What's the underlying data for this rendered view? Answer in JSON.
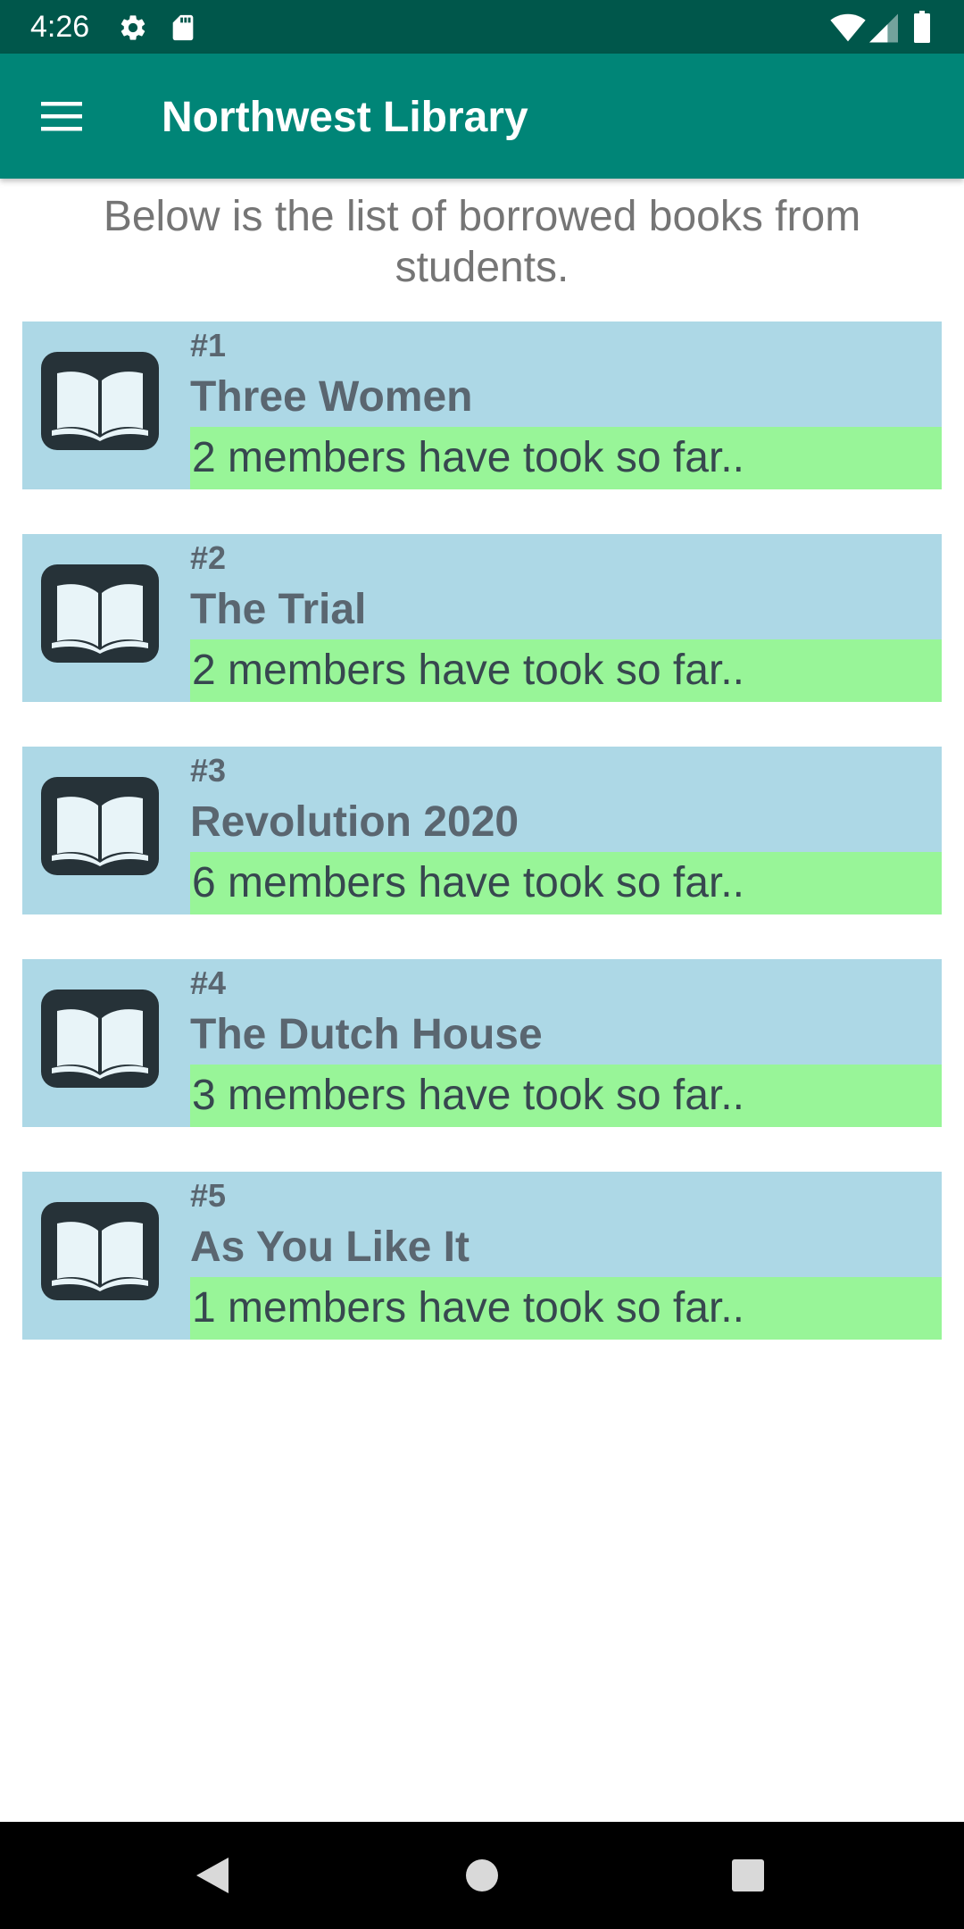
{
  "status_bar": {
    "time": "4:26",
    "left_icons": [
      "settings-icon",
      "sd-card-icon"
    ],
    "right_icons": [
      "wifi-icon",
      "cell-signal-icon",
      "battery-icon"
    ]
  },
  "app_bar": {
    "title": "Northwest Library",
    "menu_icon": "hamburger-menu-icon"
  },
  "intro_text": "Below is the list of borrowed books from students.",
  "books": [
    {
      "number": "#1",
      "title": "Three Women",
      "members": "2 members have took so far..",
      "icon": "open-book-icon"
    },
    {
      "number": "#2",
      "title": "The Trial",
      "members": "2 members have took so far..",
      "icon": "open-book-icon"
    },
    {
      "number": "#3",
      "title": "Revolution 2020",
      "members": "6 members have took so far..",
      "icon": "open-book-icon"
    },
    {
      "number": "#4",
      "title": "The Dutch House",
      "members": "3 members have took so far..",
      "icon": "open-book-icon"
    },
    {
      "number": "#5",
      "title": "As You Like It",
      "members": "1 members have took so far..",
      "icon": "open-book-icon"
    }
  ],
  "nav_bar": {
    "buttons": [
      "back-icon",
      "home-icon",
      "recents-icon"
    ]
  },
  "colors": {
    "status_bar": "#00574b",
    "app_bar": "#008577",
    "item_background": "#add8e6",
    "members_highlight": "#98f598",
    "text_gray": "#5a6670"
  }
}
